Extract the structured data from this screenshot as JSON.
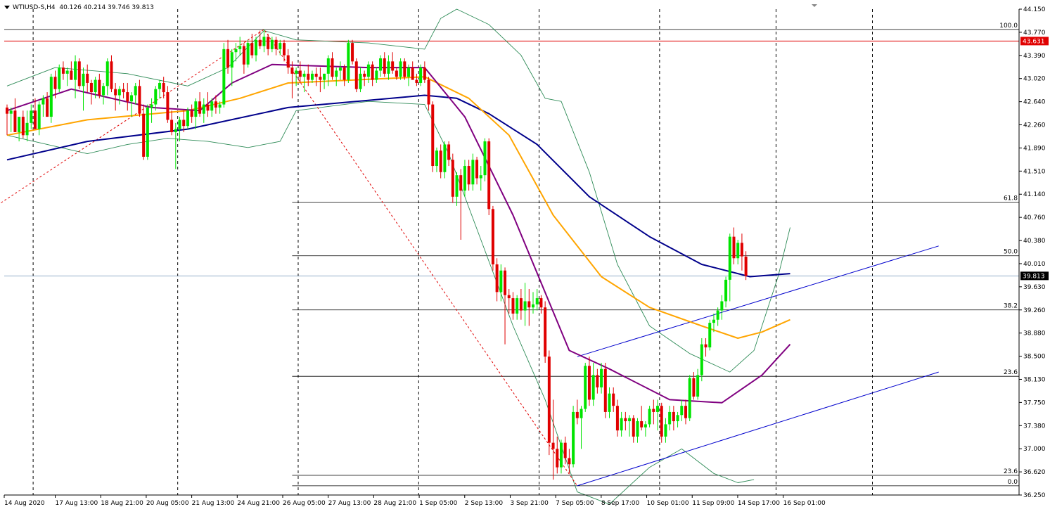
{
  "header": {
    "symbol": "WTIUSD-S,H4",
    "ohlc": "40.126 40.214 39.746 39.813"
  },
  "colors": {
    "background": "#ffffff",
    "bull": "#00e400",
    "bear": "#e00000",
    "ema_fast": "#800080",
    "ema_mid": "#ffa500",
    "ema_slow": "#00008b",
    "bollinger": "#2e8b57",
    "fib_line": "#000000",
    "resistance": "#e00000",
    "channel": "#0000cd",
    "price_marker": "#000000",
    "red_marker": "#e00000"
  },
  "chart_data": {
    "type": "candlestick",
    "timeframe": "H4",
    "ylim": [
      36.25,
      44.15
    ],
    "y_ticks": [
      "44.150",
      "43.770",
      "43.390",
      "43.020",
      "42.640",
      "42.260",
      "41.890",
      "41.510",
      "41.140",
      "40.760",
      "40.380",
      "40.010",
      "39.630",
      "39.260",
      "38.880",
      "38.500",
      "38.130",
      "37.750",
      "37.380",
      "37.000",
      "36.620",
      "36.250"
    ],
    "x_ticks": [
      "14 Aug 2020",
      "17 Aug 13:00",
      "18 Aug 21:00",
      "20 Aug 05:00",
      "21 Aug 13:00",
      "24 Aug 21:00",
      "26 Aug 05:00",
      "27 Aug 13:00",
      "28 Aug 21:00",
      "1 Sep 05:00",
      "2 Sep 13:00",
      "3 Sep 21:00",
      "7 Sep 05:00",
      "8 Sep 17:00",
      "10 Sep 01:00",
      "11 Sep 09:00",
      "14 Sep 17:00",
      "16 Sep 01:00"
    ],
    "day_separators": [
      6.5,
      42.5,
      72.5,
      102.5,
      132.5,
      162.5,
      191.5,
      215.5
    ],
    "current_price": "39.813",
    "red_level": "43.631",
    "fibonacci": [
      {
        "label": "100.0",
        "price": 43.82
      },
      {
        "label": "61.8",
        "price": 41.01
      },
      {
        "label": "50.0",
        "price": 40.14
      },
      {
        "label": "38.2",
        "price": 39.26
      },
      {
        "label": "23.6",
        "price": 38.18
      },
      {
        "label": "23.6",
        "price": 36.57
      },
      {
        "label": "0.0",
        "price": 36.4
      }
    ],
    "candles": [
      [
        42.55,
        42.6,
        42.1,
        42.45
      ],
      [
        42.45,
        42.55,
        42.15,
        42.5
      ],
      [
        42.5,
        42.7,
        42.4,
        42.15
      ],
      [
        42.15,
        42.25,
        42.0,
        42.4
      ],
      [
        42.4,
        42.5,
        42.05,
        42.1
      ],
      [
        42.1,
        42.5,
        42.0,
        42.3
      ],
      [
        42.3,
        42.6,
        42.2,
        42.5
      ],
      [
        42.5,
        42.7,
        42.3,
        42.2
      ],
      [
        42.2,
        42.65,
        42.1,
        42.6
      ],
      [
        42.6,
        42.75,
        42.4,
        42.7
      ],
      [
        42.7,
        42.8,
        42.4,
        42.4
      ],
      [
        42.4,
        43.1,
        42.3,
        43.05
      ],
      [
        43.05,
        43.15,
        42.7,
        42.85
      ],
      [
        42.85,
        43.25,
        42.8,
        43.2
      ],
      [
        43.2,
        43.3,
        43.0,
        43.1
      ],
      [
        43.1,
        43.2,
        42.9,
        43.15
      ],
      [
        43.15,
        43.3,
        43.0,
        43.0
      ],
      [
        43.0,
        43.4,
        42.7,
        43.3
      ],
      [
        43.3,
        43.35,
        42.85,
        42.9
      ],
      [
        42.9,
        43.2,
        42.5,
        43.1
      ],
      [
        43.1,
        43.25,
        42.8,
        42.95
      ],
      [
        42.95,
        43.0,
        42.6,
        42.8
      ],
      [
        42.8,
        43.05,
        42.7,
        43.0
      ],
      [
        43.0,
        43.1,
        42.7,
        42.75
      ],
      [
        42.75,
        42.95,
        42.6,
        42.9
      ],
      [
        42.9,
        43.35,
        42.75,
        43.3
      ],
      [
        43.3,
        43.4,
        42.8,
        42.85
      ],
      [
        42.85,
        42.95,
        42.5,
        42.75
      ],
      [
        42.75,
        42.9,
        42.6,
        42.85
      ],
      [
        42.85,
        42.95,
        42.7,
        42.8
      ],
      [
        42.8,
        42.95,
        42.5,
        42.65
      ],
      [
        42.65,
        42.8,
        42.4,
        42.75
      ],
      [
        42.75,
        42.95,
        42.6,
        42.9
      ],
      [
        42.9,
        43.0,
        42.4,
        42.45
      ],
      [
        42.45,
        42.6,
        41.7,
        41.75
      ],
      [
        41.75,
        42.6,
        41.7,
        42.55
      ],
      [
        42.55,
        42.7,
        42.3,
        42.6
      ],
      [
        42.6,
        42.9,
        42.5,
        42.85
      ],
      [
        42.85,
        43.0,
        42.7,
        42.95
      ],
      [
        42.95,
        43.05,
        42.7,
        42.8
      ],
      [
        42.8,
        42.9,
        42.3,
        42.35
      ],
      [
        42.35,
        42.5,
        42.1,
        42.15
      ],
      [
        42.15,
        42.3,
        41.55,
        42.2
      ],
      [
        42.2,
        42.4,
        42.0,
        42.35
      ],
      [
        42.35,
        42.5,
        42.15,
        42.25
      ],
      [
        42.25,
        42.55,
        42.2,
        42.5
      ],
      [
        42.5,
        42.6,
        42.3,
        42.4
      ],
      [
        42.4,
        42.7,
        42.2,
        42.65
      ],
      [
        42.65,
        42.8,
        42.4,
        42.45
      ],
      [
        42.45,
        42.7,
        42.3,
        42.6
      ],
      [
        42.6,
        42.8,
        42.4,
        42.5
      ],
      [
        42.5,
        42.7,
        42.4,
        42.65
      ],
      [
        42.65,
        42.75,
        42.45,
        42.55
      ],
      [
        42.55,
        42.65,
        42.45,
        42.6
      ],
      [
        42.6,
        43.6,
        42.55,
        43.5
      ],
      [
        43.5,
        43.65,
        43.1,
        43.2
      ],
      [
        43.2,
        43.5,
        42.9,
        43.45
      ],
      [
        43.45,
        43.6,
        43.3,
        43.5
      ],
      [
        43.5,
        43.7,
        43.4,
        43.55
      ],
      [
        43.55,
        43.6,
        43.1,
        43.25
      ],
      [
        43.25,
        43.65,
        43.2,
        43.6
      ],
      [
        43.6,
        43.75,
        43.35,
        43.4
      ],
      [
        43.4,
        43.7,
        43.3,
        43.65
      ],
      [
        43.65,
        43.8,
        43.5,
        43.55
      ],
      [
        43.55,
        43.82,
        43.45,
        43.7
      ],
      [
        43.7,
        43.75,
        43.4,
        43.5
      ],
      [
        43.5,
        43.7,
        43.45,
        43.65
      ],
      [
        43.65,
        43.7,
        43.4,
        43.5
      ],
      [
        43.5,
        43.65,
        43.4,
        43.6
      ],
      [
        43.6,
        43.65,
        43.3,
        43.4
      ],
      [
        43.4,
        43.5,
        43.1,
        43.2
      ],
      [
        43.2,
        43.3,
        42.7,
        43.1
      ],
      [
        43.1,
        43.2,
        42.9,
        43.15
      ],
      [
        43.15,
        43.3,
        42.95,
        43.05
      ],
      [
        43.05,
        43.15,
        42.8,
        43.1
      ],
      [
        43.1,
        43.25,
        42.9,
        43.0
      ],
      [
        43.0,
        43.15,
        42.95,
        43.1
      ],
      [
        43.1,
        43.2,
        42.9,
        43.05
      ],
      [
        43.05,
        43.2,
        42.8,
        43.0
      ],
      [
        43.0,
        43.1,
        42.85,
        43.1
      ],
      [
        43.1,
        43.4,
        42.9,
        43.35
      ],
      [
        43.35,
        43.45,
        43.0,
        43.05
      ],
      [
        43.05,
        43.2,
        42.9,
        43.15
      ],
      [
        43.15,
        43.3,
        43.0,
        43.2
      ],
      [
        43.2,
        43.25,
        42.9,
        43.0
      ],
      [
        43.0,
        43.65,
        42.95,
        43.6
      ],
      [
        43.6,
        43.65,
        43.25,
        43.3
      ],
      [
        43.3,
        43.35,
        42.8,
        42.85
      ],
      [
        42.85,
        43.2,
        42.8,
        43.1
      ],
      [
        43.1,
        43.15,
        42.9,
        43.05
      ],
      [
        43.05,
        43.3,
        42.95,
        43.25
      ],
      [
        43.25,
        43.3,
        42.9,
        43.0
      ],
      [
        43.0,
        43.2,
        42.95,
        43.15
      ],
      [
        43.15,
        43.4,
        43.05,
        43.35
      ],
      [
        43.35,
        43.45,
        43.05,
        43.1
      ],
      [
        43.1,
        43.4,
        43.0,
        43.3
      ],
      [
        43.3,
        43.45,
        43.1,
        43.15
      ],
      [
        43.15,
        43.2,
        43.0,
        43.05
      ],
      [
        43.05,
        43.35,
        43.0,
        43.3
      ],
      [
        43.3,
        43.35,
        43.0,
        43.05
      ],
      [
        43.05,
        43.25,
        42.9,
        43.2
      ],
      [
        43.2,
        43.3,
        43.0,
        43.0
      ],
      [
        43.0,
        43.1,
        42.9,
        42.95
      ],
      [
        42.95,
        43.25,
        42.9,
        43.2
      ],
      [
        43.2,
        43.3,
        42.95,
        43.0
      ],
      [
        43.0,
        43.05,
        42.5,
        42.6
      ],
      [
        42.6,
        42.65,
        41.5,
        41.6
      ],
      [
        41.6,
        41.9,
        41.5,
        41.85
      ],
      [
        41.85,
        41.95,
        41.4,
        41.5
      ],
      [
        41.5,
        42.0,
        41.4,
        41.95
      ],
      [
        41.95,
        42.0,
        41.6,
        41.7
      ],
      [
        41.7,
        41.8,
        41.0,
        41.1
      ],
      [
        41.1,
        41.5,
        40.95,
        41.45
      ],
      [
        41.45,
        41.55,
        40.4,
        41.2
      ],
      [
        41.2,
        41.7,
        41.1,
        41.6
      ],
      [
        41.6,
        41.7,
        41.2,
        41.3
      ],
      [
        41.3,
        41.8,
        41.2,
        41.7
      ],
      [
        41.7,
        41.75,
        41.3,
        41.4
      ],
      [
        41.4,
        41.6,
        41.2,
        41.45
      ],
      [
        41.45,
        42.05,
        41.35,
        42.0
      ],
      [
        42.0,
        42.05,
        40.8,
        40.9
      ],
      [
        40.9,
        40.95,
        39.9,
        40.0
      ],
      [
        40.0,
        40.1,
        39.4,
        39.55
      ],
      [
        39.55,
        40.0,
        39.4,
        39.9
      ],
      [
        39.9,
        39.95,
        38.7,
        39.5
      ],
      [
        39.5,
        39.6,
        39.2,
        39.45
      ],
      [
        39.45,
        39.55,
        39.1,
        39.2
      ],
      [
        39.2,
        39.5,
        39.1,
        39.45
      ],
      [
        39.45,
        39.6,
        39.1,
        39.25
      ],
      [
        39.25,
        39.7,
        39.0,
        39.4
      ],
      [
        39.4,
        39.6,
        39.0,
        39.3
      ],
      [
        39.3,
        39.55,
        39.2,
        39.35
      ],
      [
        39.35,
        39.6,
        39.25,
        39.45
      ],
      [
        39.45,
        39.5,
        39.2,
        39.3
      ],
      [
        39.3,
        39.4,
        38.4,
        38.5
      ],
      [
        38.5,
        38.6,
        36.9,
        37.1
      ],
      [
        37.1,
        37.8,
        36.5,
        37.0
      ],
      [
        37.0,
        37.2,
        36.6,
        36.7
      ],
      [
        36.7,
        37.15,
        36.6,
        37.1
      ],
      [
        37.1,
        37.2,
        36.75,
        36.85
      ],
      [
        36.85,
        37.0,
        36.6,
        36.75
      ],
      [
        36.75,
        37.7,
        36.7,
        37.6
      ],
      [
        37.6,
        37.8,
        37.4,
        37.5
      ],
      [
        37.5,
        37.7,
        37.0,
        37.65
      ],
      [
        37.65,
        38.4,
        37.6,
        38.35
      ],
      [
        38.35,
        38.5,
        37.7,
        37.8
      ],
      [
        37.8,
        38.4,
        37.7,
        38.2
      ],
      [
        38.2,
        38.3,
        37.9,
        38.0
      ],
      [
        38.0,
        38.4,
        37.9,
        38.3
      ],
      [
        38.3,
        38.4,
        37.5,
        37.6
      ],
      [
        37.6,
        38.0,
        37.5,
        37.9
      ],
      [
        37.9,
        38.0,
        37.6,
        37.7
      ],
      [
        37.7,
        37.8,
        37.2,
        37.3
      ],
      [
        37.3,
        37.6,
        37.2,
        37.5
      ],
      [
        37.5,
        37.6,
        37.3,
        37.45
      ],
      [
        37.45,
        37.55,
        37.2,
        37.5
      ],
      [
        37.5,
        37.55,
        37.1,
        37.2
      ],
      [
        37.2,
        37.5,
        37.1,
        37.45
      ],
      [
        37.45,
        37.7,
        37.3,
        37.35
      ],
      [
        37.35,
        37.45,
        37.2,
        37.4
      ],
      [
        37.4,
        37.7,
        37.35,
        37.65
      ],
      [
        37.65,
        37.8,
        37.4,
        37.6
      ],
      [
        37.6,
        37.8,
        37.3,
        37.7
      ],
      [
        37.7,
        37.75,
        37.1,
        37.2
      ],
      [
        37.2,
        37.5,
        37.1,
        37.4
      ],
      [
        37.4,
        37.7,
        37.3,
        37.6
      ],
      [
        37.6,
        37.7,
        37.3,
        37.45
      ],
      [
        37.45,
        37.6,
        37.35,
        37.55
      ],
      [
        37.55,
        37.8,
        37.45,
        37.7
      ],
      [
        37.7,
        37.8,
        37.4,
        37.5
      ],
      [
        37.5,
        38.2,
        37.45,
        38.15
      ],
      [
        38.15,
        38.25,
        37.8,
        37.85
      ],
      [
        37.85,
        38.3,
        37.8,
        38.2
      ],
      [
        38.2,
        38.8,
        38.1,
        38.7
      ],
      [
        38.7,
        38.8,
        38.5,
        38.65
      ],
      [
        38.65,
        39.1,
        38.6,
        39.05
      ],
      [
        39.05,
        39.2,
        38.9,
        39.1
      ],
      [
        39.1,
        39.3,
        39.0,
        39.25
      ],
      [
        39.25,
        39.5,
        39.1,
        39.4
      ],
      [
        39.4,
        39.8,
        39.3,
        39.75
      ],
      [
        39.75,
        40.5,
        39.4,
        40.45
      ],
      [
        40.45,
        40.6,
        40.0,
        40.1
      ],
      [
        40.1,
        40.4,
        40.0,
        40.35
      ],
      [
        40.35,
        40.5,
        39.9,
        40.13
      ],
      [
        40.126,
        40.214,
        39.746,
        39.813
      ]
    ],
    "ema_fast": [
      [
        0,
        42.5
      ],
      [
        16,
        42.85
      ],
      [
        36,
        42.55
      ],
      [
        48,
        42.5
      ],
      [
        56,
        42.95
      ],
      [
        66,
        43.25
      ],
      [
        90,
        43.2
      ],
      [
        104,
        43.2
      ],
      [
        114,
        42.4
      ],
      [
        126,
        40.8
      ],
      [
        140,
        38.6
      ],
      [
        150,
        38.3
      ],
      [
        165,
        37.8
      ],
      [
        178,
        37.75
      ],
      [
        188,
        38.2
      ],
      [
        195,
        38.7
      ]
    ],
    "ema_mid": [
      [
        0,
        42.1
      ],
      [
        20,
        42.35
      ],
      [
        45,
        42.5
      ],
      [
        58,
        42.7
      ],
      [
        70,
        42.95
      ],
      [
        104,
        43.05
      ],
      [
        115,
        42.7
      ],
      [
        125,
        42.1
      ],
      [
        136,
        40.8
      ],
      [
        148,
        39.8
      ],
      [
        160,
        39.3
      ],
      [
        173,
        39.0
      ],
      [
        182,
        38.8
      ],
      [
        188,
        38.9
      ],
      [
        195,
        39.1
      ]
    ],
    "ema_slow": [
      [
        0,
        41.7
      ],
      [
        20,
        42.0
      ],
      [
        45,
        42.2
      ],
      [
        70,
        42.55
      ],
      [
        104,
        42.75
      ],
      [
        112,
        42.7
      ],
      [
        120,
        42.45
      ],
      [
        132,
        41.95
      ],
      [
        145,
        41.1
      ],
      [
        160,
        40.45
      ],
      [
        173,
        40.0
      ],
      [
        185,
        39.8
      ],
      [
        195,
        39.85
      ]
    ],
    "bollinger_upper": [
      [
        0,
        42.9
      ],
      [
        12,
        43.2
      ],
      [
        30,
        43.1
      ],
      [
        45,
        42.9
      ],
      [
        55,
        43.2
      ],
      [
        64,
        43.8
      ],
      [
        72,
        43.65
      ],
      [
        90,
        43.6
      ],
      [
        104,
        43.5
      ],
      [
        108,
        44.0
      ],
      [
        112,
        44.15
      ],
      [
        120,
        43.9
      ],
      [
        128,
        43.4
      ],
      [
        134,
        42.7
      ],
      [
        138,
        42.65
      ],
      [
        145,
        41.5
      ],
      [
        152,
        40.0
      ],
      [
        160,
        39.0
      ],
      [
        170,
        38.55
      ],
      [
        180,
        38.25
      ],
      [
        186,
        38.6
      ],
      [
        192,
        39.8
      ],
      [
        195,
        40.6
      ]
    ],
    "bollinger_lower": [
      [
        0,
        42.1
      ],
      [
        10,
        41.95
      ],
      [
        20,
        41.8
      ],
      [
        30,
        41.95
      ],
      [
        40,
        42.05
      ],
      [
        50,
        42.0
      ],
      [
        60,
        41.9
      ],
      [
        68,
        42.0
      ],
      [
        72,
        42.5
      ],
      [
        90,
        42.65
      ],
      [
        104,
        42.6
      ],
      [
        110,
        41.8
      ],
      [
        118,
        40.4
      ],
      [
        126,
        39.0
      ],
      [
        134,
        37.8
      ],
      [
        142,
        36.3
      ],
      [
        150,
        36.1
      ],
      [
        160,
        36.7
      ],
      [
        168,
        37.0
      ],
      [
        176,
        36.6
      ],
      [
        182,
        36.45
      ],
      [
        186,
        36.5
      ]
    ],
    "trendline_dotted": [
      [
        -5,
        40.85
      ],
      [
        64,
        43.82
      ],
      [
        142,
        36.4
      ]
    ],
    "channel_lines": [
      [
        [
          142,
          36.4
        ],
        [
          232,
          38.25
        ]
      ],
      [
        [
          142,
          38.5
        ],
        [
          232,
          40.3
        ]
      ]
    ]
  }
}
